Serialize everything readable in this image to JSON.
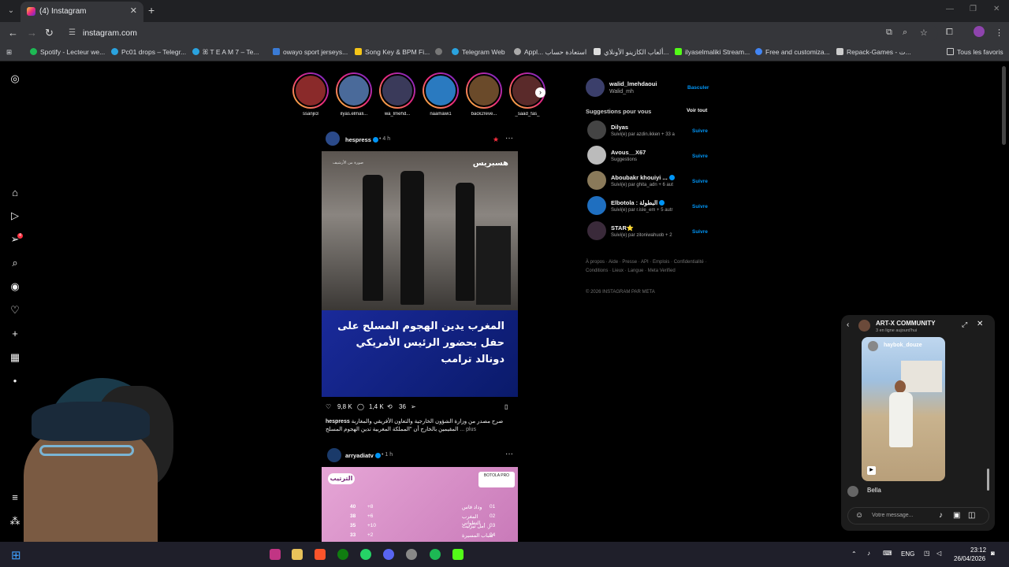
{
  "browser": {
    "tab_title": "(4) Instagram",
    "url": "instagram.com",
    "bookmarks": [
      "Spotify - Lecteur we...",
      "Pc01 drops – Telegr...",
      "ꕤ T E A M 7 – Te...",
      "owayo sport jerseys...",
      "Song Key & BPM Fi...",
      "Telegram Web",
      "Appl...",
      "استعادة حساب",
      "ألعاب الكازينو الأونلاي...",
      "ilyaselmaliki Stream...",
      "Free and customiza...",
      "Repack-Games - ت...",
      "Tous les favoris"
    ]
  },
  "sidebar": {
    "notification_count": "4"
  },
  "stories": [
    {
      "name": "ssanjii3"
    },
    {
      "name": "ilyas.elmali..."
    },
    {
      "name": "wa_lmehd..."
    },
    {
      "name": "naamawi1"
    },
    {
      "name": "back2reve..."
    },
    {
      "name": "_saad_fas_"
    }
  ],
  "post1": {
    "user": "hespress",
    "time": "• 4 h",
    "photo_brand": "هسبريس",
    "photo_sub": "صورة من الأرشيف",
    "headline": "المغرب يدين الهجوم المسلح على حفل بحضور الرئيس الأمريكي دونالد ترامب",
    "likes": "9,8 K",
    "comments": "1,4 K",
    "reposts": "36",
    "caption_user": "hespress",
    "caption_text": "صرح مصدر من وزارة الشؤون الخارجية والتعاون الأفريقي والمغاربة المقيمين بالخارج أن \"المملكة المغربية تدين الهجوم المسلح",
    "more": "... plus"
  },
  "post2": {
    "user": "arryadiatv",
    "time": "• 1 h",
    "table_title": "الترتيب",
    "league": "BOTOLA PRO",
    "rows": [
      {
        "pts": "40",
        "diff": "+8",
        "team": "وداد فاس",
        "rank": "01"
      },
      {
        "pts": "38",
        "diff": "+6",
        "team": "المغرب التطواني",
        "rank": "02"
      },
      {
        "pts": "35",
        "diff": "+10",
        "team": "ر. أمل تيزنيت",
        "rank": "03"
      },
      {
        "pts": "33",
        "diff": "+2",
        "team": "شباب المسيرة",
        "rank": "04"
      }
    ]
  },
  "right_panel": {
    "me_user": "walid_lmehdaoui",
    "me_name": "Walid_mh",
    "switch": "Basculer",
    "suggestions_title": "Suggestions pour vous",
    "see_all": "Voir tout",
    "suggestions": [
      {
        "name": "Dilyas",
        "sub": "Suivi(e) par azdin.ikken + 33 a",
        "follow": "Suivre"
      },
      {
        "name": "Avous__X67",
        "sub": "Suggestions",
        "follow": "Suivre"
      },
      {
        "name": "Aboubakr khouiyi ...",
        "sub": "Suivi(e) par ghita_adn + 6 aut",
        "follow": "Suivre"
      },
      {
        "name": "Elbotola : البطولة",
        "sub": "Suivi(e) par r.isle_em + 5 autr",
        "follow": "Suivre"
      },
      {
        "name": "STAR⭐",
        "sub": "Suivi(e) par zitoniwahuob + 2",
        "follow": "Suivre"
      }
    ],
    "footer": "À propos · Aide · Presse · API · Emplois · Confidentialité · Conditions · Lieux · Langue · Meta Verified",
    "copyright": "© 2026 INSTAGRAM PAR META"
  },
  "chat": {
    "title": "ART-X COMMUNITY",
    "subtitle": "3 en ligne aujourd'hui",
    "video_user": "haybok_douze",
    "message": "Bella",
    "placeholder": "Votre message..."
  },
  "taskbar": {
    "lang": "ENG",
    "time": "23:12",
    "date": "26/04/2026"
  }
}
